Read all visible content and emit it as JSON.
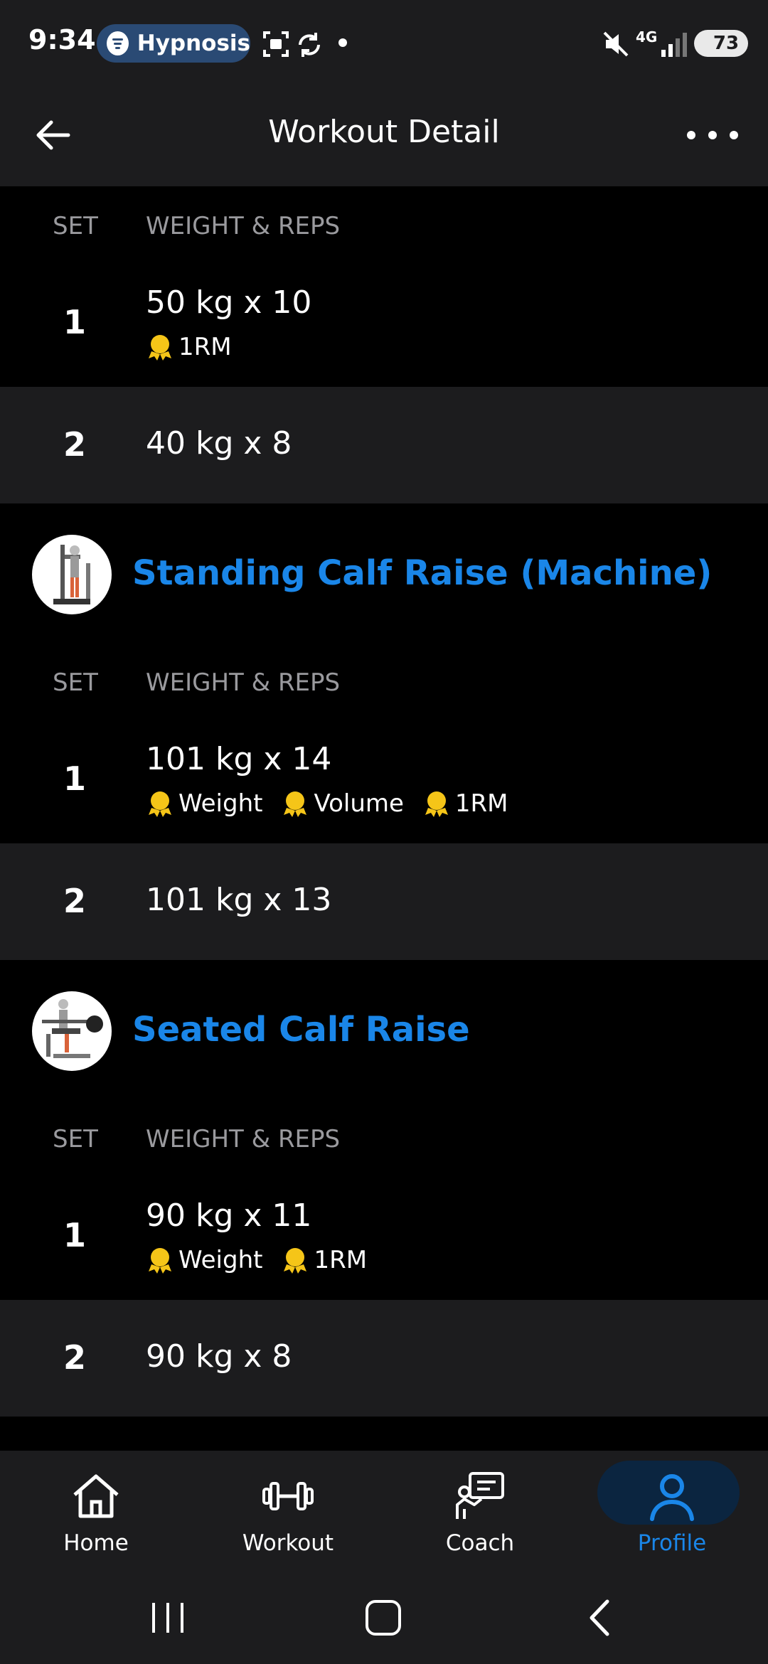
{
  "status_bar": {
    "time": "9:34",
    "spotify_label": "Hypnosis",
    "battery": "73",
    "network": "4G"
  },
  "header": {
    "title": "Workout Detail"
  },
  "columns": {
    "set": "SET",
    "weight_reps": "WEIGHT & REPS"
  },
  "exercises": [
    {
      "name": "",
      "sets": [
        {
          "num": "1",
          "value": "50 kg x 10",
          "badges": [
            "1RM"
          ]
        },
        {
          "num": "2",
          "value": "40 kg x 8",
          "badges": []
        }
      ]
    },
    {
      "name": "Standing Calf Raise (Machine)",
      "sets": [
        {
          "num": "1",
          "value": "101 kg x 14",
          "badges": [
            "Weight",
            "Volume",
            "1RM"
          ]
        },
        {
          "num": "2",
          "value": "101 kg x 13",
          "badges": []
        }
      ]
    },
    {
      "name": "Seated Calf Raise",
      "sets": [
        {
          "num": "1",
          "value": "90 kg x 11",
          "badges": [
            "Weight",
            "1RM"
          ]
        },
        {
          "num": "2",
          "value": "90 kg x 8",
          "badges": []
        }
      ]
    }
  ],
  "bottom_nav": [
    {
      "label": "Home",
      "icon": "home-icon",
      "active": false
    },
    {
      "label": "Workout",
      "icon": "dumbbell-icon",
      "active": false
    },
    {
      "label": "Coach",
      "icon": "coach-icon",
      "active": false
    },
    {
      "label": "Profile",
      "icon": "profile-icon",
      "active": true
    }
  ],
  "colors": {
    "accent": "#1a86e8",
    "surface": "#1c1c1e",
    "background": "#000000",
    "medal": "#f5c518"
  }
}
